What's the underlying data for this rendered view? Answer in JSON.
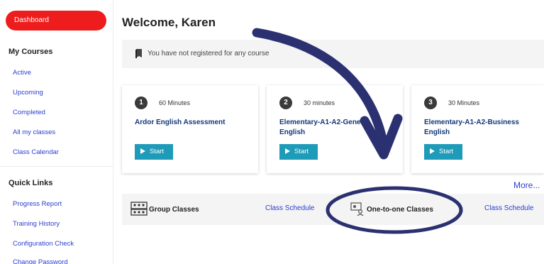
{
  "sidebar": {
    "dashboard_label": "Dashboard",
    "my_courses": {
      "title": "My Courses",
      "items": [
        "Active",
        "Upcoming",
        "Completed",
        "All my classes",
        "Class Calendar"
      ]
    },
    "quick_links": {
      "title": "Quick Links",
      "items": [
        "Progress Report",
        "Training History",
        "Configuration Check",
        "Change Password"
      ]
    }
  },
  "main": {
    "welcome": "Welcome, Karen",
    "notice": "You have not registered for any course",
    "courses": [
      {
        "number": "1",
        "duration": "60 Minutes",
        "title": "Ardor English Assessment",
        "start_label": "Start"
      },
      {
        "number": "2",
        "duration": "30 minutes",
        "title": "Elementary-A1-A2-General English",
        "start_label": "Start"
      },
      {
        "number": "3",
        "duration": "30 Minutes",
        "title": "Elementary-A1-A2-Business English",
        "start_label": "Start"
      }
    ],
    "more_label": "More...",
    "classes": {
      "group_label": "Group Classes",
      "group_schedule": "Class Schedule",
      "one_to_one_label": "One-to-one Classes",
      "one_to_one_schedule": "Class Schedule"
    }
  },
  "colors": {
    "accent_red": "#ee1c1c",
    "link_blue": "#2a3fcf",
    "start_teal": "#1e9bb8",
    "annotation_navy": "#2b3170"
  },
  "icons": [
    "book-icon",
    "play-icon",
    "group-classes-icon",
    "one-to-one-icon"
  ]
}
